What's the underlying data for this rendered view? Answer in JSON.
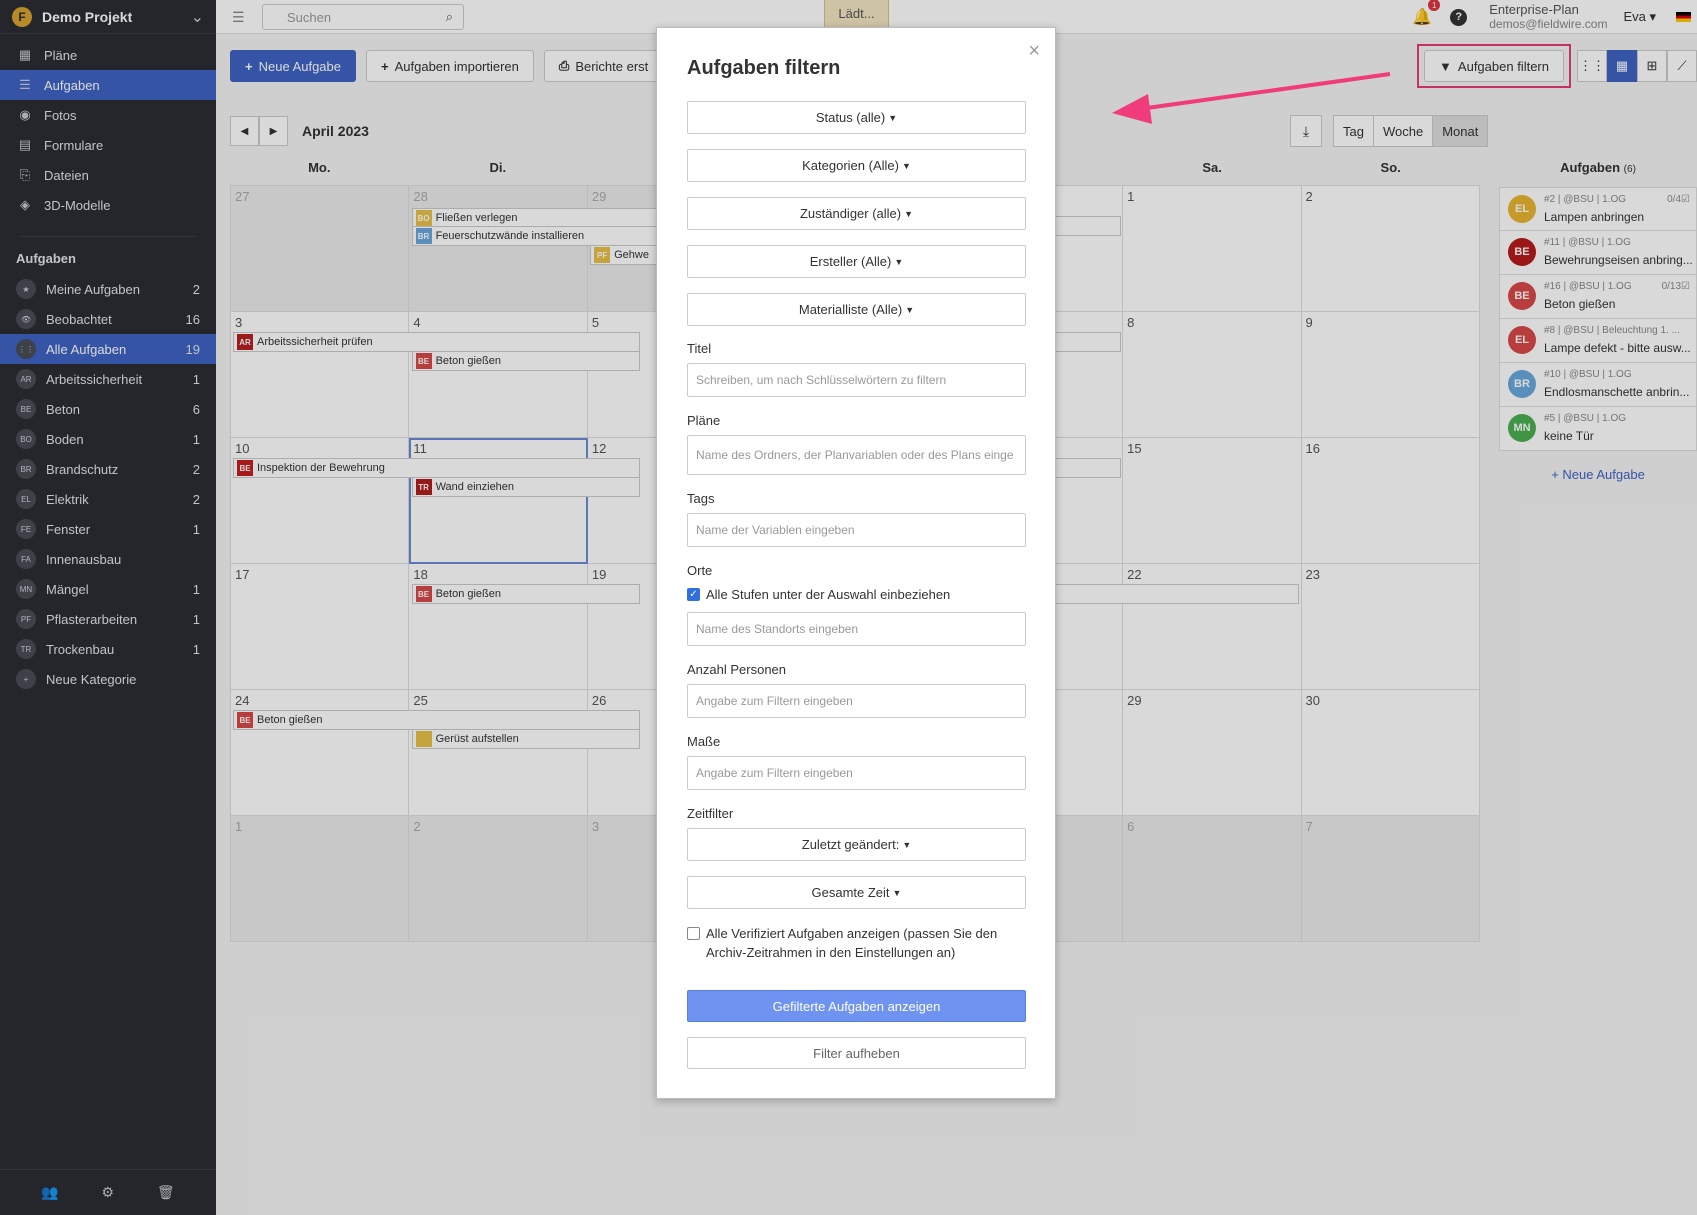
{
  "project": {
    "name": "Demo Projekt",
    "logo": "F"
  },
  "nav": [
    {
      "icon": "▦",
      "label": "Pläne"
    },
    {
      "icon": "☰",
      "label": "Aufgaben",
      "active": true
    },
    {
      "icon": "◉",
      "label": "Fotos"
    },
    {
      "icon": "▤",
      "label": "Formulare"
    },
    {
      "icon": "⎘",
      "label": "Dateien"
    },
    {
      "icon": "◈",
      "label": "3D-Modelle"
    }
  ],
  "sidebar_section": "Aufgaben",
  "categories": [
    {
      "badge": "★",
      "label": "Meine Aufgaben",
      "count": "2"
    },
    {
      "badge": "👁",
      "label": "Beobachtet",
      "count": "16"
    },
    {
      "badge": "⋮⋮",
      "label": "Alle Aufgaben",
      "count": "19",
      "active": true
    },
    {
      "badge": "AR",
      "label": "Arbeitssicherheit",
      "count": "1"
    },
    {
      "badge": "BE",
      "label": "Beton",
      "count": "6"
    },
    {
      "badge": "BO",
      "label": "Boden",
      "count": "1"
    },
    {
      "badge": "BR",
      "label": "Brandschutz",
      "count": "2"
    },
    {
      "badge": "EL",
      "label": "Elektrik",
      "count": "2"
    },
    {
      "badge": "FE",
      "label": "Fenster",
      "count": "1"
    },
    {
      "badge": "FA",
      "label": "Innenausbau",
      "count": ""
    },
    {
      "badge": "MN",
      "label": "Mängel",
      "count": "1"
    },
    {
      "badge": "PF",
      "label": "Pflasterarbeiten",
      "count": "1"
    },
    {
      "badge": "TR",
      "label": "Trockenbau",
      "count": "1"
    },
    {
      "badge": "+",
      "label": "Neue Kategorie",
      "count": ""
    }
  ],
  "topbar": {
    "search_placeholder": "Suchen",
    "loading": "Lädt...",
    "notif_count": "1",
    "plan": "Enterprise-Plan",
    "email": "demos@fieldwire.com",
    "user": "Eva ▾"
  },
  "toolbar": {
    "new_task": "Neue Aufgabe",
    "import": "Aufgaben importieren",
    "reports": "Berichte erst",
    "filter": "Aufgaben filtern"
  },
  "calendar": {
    "month": "April 2023",
    "views": [
      "Tag",
      "Woche",
      "Monat"
    ],
    "days": [
      "Mo.",
      "Di.",
      "",
      "",
      "",
      "Sa.",
      "So."
    ],
    "weeks": [
      [
        "27",
        "28",
        "29",
        "",
        "",
        "1",
        "2"
      ],
      [
        "3",
        "4",
        "5",
        "",
        "",
        "8",
        "9"
      ],
      [
        "10",
        "11",
        "12",
        "",
        "",
        "15",
        "16"
      ],
      [
        "17",
        "18",
        "19",
        "",
        "",
        "22",
        "23"
      ],
      [
        "24",
        "25",
        "26",
        "",
        "",
        "29",
        "30"
      ],
      [
        "1",
        "2",
        "3",
        "",
        "",
        "6",
        "7"
      ]
    ],
    "events": [
      {
        "badge": "BO",
        "label": "Fließen verlegen",
        "color": "#e8c048"
      },
      {
        "badge": "BR",
        "label": "Feuerschutzwände installieren",
        "color": "#6aa9dc"
      },
      {
        "badge": "PF",
        "label": "Gehwe",
        "color": "#e8c048"
      },
      {
        "badge": "AR",
        "label": "Arbeitssicherheit prüfen",
        "color": "#b32121"
      },
      {
        "badge": "BE",
        "label": "Beton gießen",
        "color": "#d94848"
      },
      {
        "badge": "BE",
        "label": "Inspektion der Bewehrung",
        "color": "#c22020"
      },
      {
        "badge": "TR",
        "label": "Wand einziehen",
        "color": "#b01e1e"
      },
      {
        "badge": "BE",
        "label": "Beton gießen",
        "color": "#d94848"
      },
      {
        "badge": "BE",
        "label": "Beton gießen",
        "color": "#d94848"
      },
      {
        "badge": "",
        "label": "Gerüst aufstellen",
        "color": "#e8c048"
      }
    ]
  },
  "task_panel": {
    "title": "Aufgaben",
    "count": "(6)",
    "tasks": [
      {
        "pin": "EL",
        "color": "#e8b530",
        "meta": "#2 | @BSU | 1.OG",
        "cnt": "0/4☑",
        "title": "Lampen anbringen"
      },
      {
        "pin": "BE",
        "color": "#b71c1c",
        "meta": "#11 | @BSU | 1.OG",
        "cnt": "",
        "title": "Bewehrungseisen anbring..."
      },
      {
        "pin": "BE",
        "color": "#d94848",
        "meta": "#16 | @BSU | 1.OG",
        "cnt": "0/13☑",
        "title": "Beton gießen"
      },
      {
        "pin": "EL",
        "color": "#d94848",
        "meta": "#8 | @BSU | Beleuchtung 1. ...",
        "cnt": "",
        "title": "Lampe defekt - bitte ausw..."
      },
      {
        "pin": "BR",
        "color": "#6aa9dc",
        "meta": "#10 | @BSU | 1.OG",
        "cnt": "",
        "title": "Endlosmanschette anbrin..."
      },
      {
        "pin": "MN",
        "color": "#4caf50",
        "meta": "#5 | @BSU | 1.OG",
        "cnt": "",
        "title": "keine Tür"
      }
    ],
    "new_task": "+ Neue Aufgabe"
  },
  "modal": {
    "title": "Aufgaben filtern",
    "dropdowns": [
      "Status (alle)",
      "Kategorien (Alle)",
      "Zuständiger (alle)",
      "Ersteller (Alle)",
      "Materialliste (Alle)"
    ],
    "titel_label": "Titel",
    "titel_ph": "Schreiben, um nach Schlüsselwörtern zu filtern",
    "plaene_label": "Pläne",
    "plaene_ph": "Name des Ordners, der Planvariablen oder des Plans einge",
    "tags_label": "Tags",
    "tags_ph": "Name der Variablen eingeben",
    "orte_label": "Orte",
    "orte_check": "Alle Stufen unter der Auswahl einbeziehen",
    "orte_ph": "Name des Standorts eingeben",
    "personen_label": "Anzahl Personen",
    "personen_ph": "Angabe zum Filtern eingeben",
    "masse_label": "Maße",
    "masse_ph": "Angabe zum Filtern eingeben",
    "zeit_label": "Zeitfilter",
    "zeit_dd1": "Zuletzt geändert:",
    "zeit_dd2": "Gesamte Zeit",
    "verified_check": "Alle Verifiziert Aufgaben anzeigen (passen Sie den Archiv-Zeitrahmen in den Einstellungen an)",
    "apply": "Gefilterte Aufgaben anzeigen",
    "clear": "Filter aufheben"
  },
  "colors": {
    "accent": "#3f63c4",
    "highlight": "#e63a7a",
    "sidebar": "#2b2d33"
  }
}
